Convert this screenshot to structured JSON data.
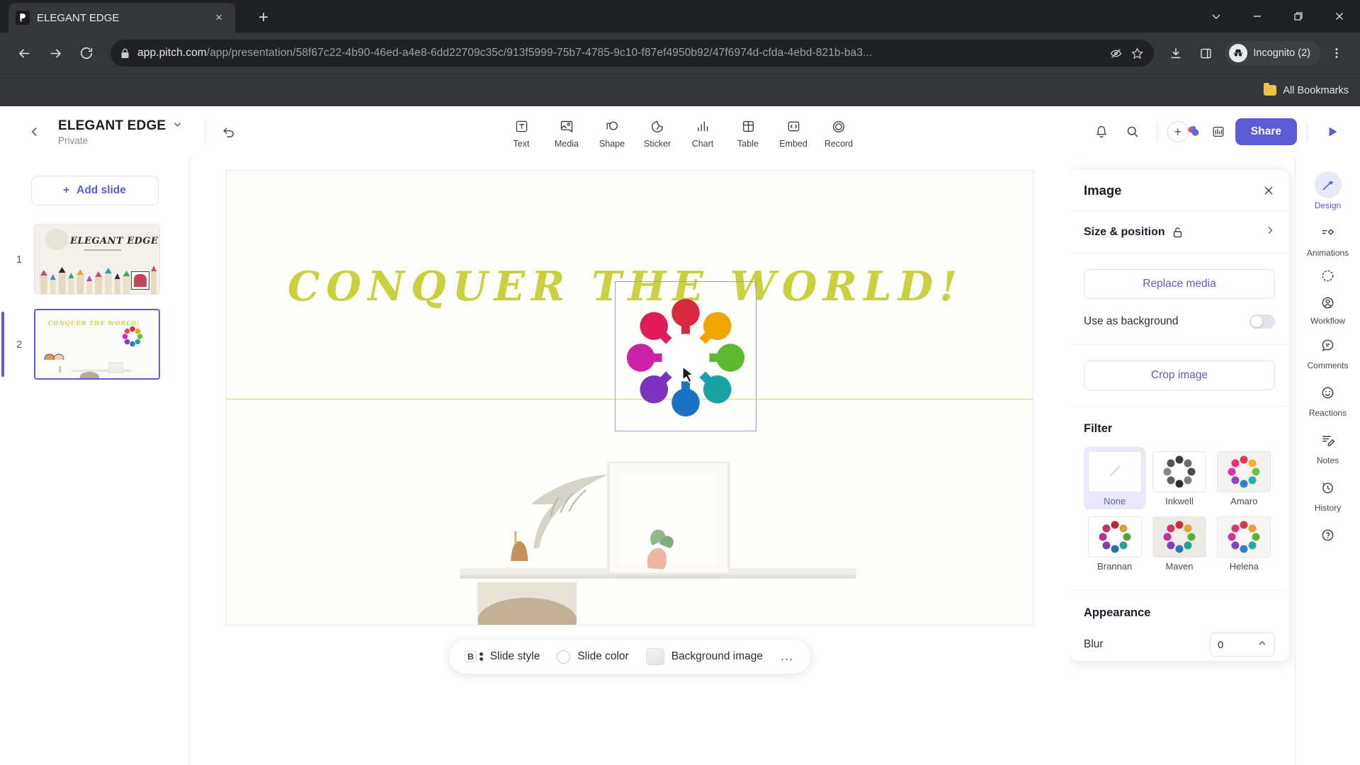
{
  "browser": {
    "tab": {
      "title": "ELEGANT EDGE",
      "favicon": "pitch-logo-icon",
      "close": "×"
    },
    "new_tab": "+",
    "window_controls": [
      "chevron-down-icon",
      "minimize-icon",
      "restore-icon",
      "close-icon"
    ],
    "nav": {
      "back": "back-icon",
      "forward": "forward-icon",
      "reload": "reload-icon"
    },
    "omnibox": {
      "lock": "lock-icon",
      "domain": "app.pitch.com",
      "path": "/app/presentation/58f67c22-4b90-46ed-a4e8-6dd22709c35c/913f5999-75b7-4785-9c10-f87ef4950b92/47f6974d-cfda-4ebd-821b-ba3...",
      "tracking_protection": "eye-slash-icon",
      "bookmark": "star-icon"
    },
    "toolbar_icons": [
      "download-icon",
      "side-panel-icon"
    ],
    "profile": {
      "label": "Incognito (2)",
      "icon": "incognito-icon"
    },
    "menu": "kebab-menu-icon",
    "bookmarks_bar": {
      "label": "All Bookmarks",
      "icon": "folder-icon"
    }
  },
  "app": {
    "header": {
      "back": "chevron-left-icon",
      "deck_title": "ELEGANT EDGE",
      "deck_title_caret": "chevron-down-icon",
      "privacy": "Private",
      "undo": "undo-icon",
      "insert_tools": [
        {
          "label": "Text",
          "icon": "text-icon"
        },
        {
          "label": "Media",
          "icon": "media-icon"
        },
        {
          "label": "Shape",
          "icon": "shape-icon"
        },
        {
          "label": "Sticker",
          "icon": "sticker-icon"
        },
        {
          "label": "Chart",
          "icon": "chart-icon"
        },
        {
          "label": "Table",
          "icon": "table-icon"
        },
        {
          "label": "Embed",
          "icon": "embed-icon"
        },
        {
          "label": "Record",
          "icon": "record-icon"
        }
      ],
      "notifications": "bell-icon",
      "search": "search-icon",
      "add_collaborator": "plus-icon",
      "analytics": "analytics-icon",
      "share_label": "Share",
      "present": "play-icon"
    },
    "slides_pane": {
      "add_slide_label": "Add slide",
      "add_slide_icon": "plus-icon",
      "slides": [
        {
          "number": "1",
          "title": "ELEGANT EDGE",
          "active": false
        },
        {
          "number": "2",
          "title": "CONQUER THE WORLD!",
          "active": true
        }
      ]
    },
    "canvas": {
      "headline": "CONQUER THE WORLD!",
      "headline_color": "#c9d13f",
      "selected_element": "star-people-image",
      "cursor": "pointer-cursor"
    },
    "style_bar": {
      "slide_style": "Slide style",
      "slide_style_icon": "text-style-icon",
      "slide_color": "Slide color",
      "slide_color_icon": "color-circle-icon",
      "background_image": "Background image",
      "background_image_icon": "image-swatch-icon",
      "more": "…"
    },
    "right_panel": {
      "title": "Image",
      "close": "close-icon",
      "size_position": {
        "label": "Size & position",
        "lock_icon": "unlock-icon",
        "chevron": "chevron-right-icon"
      },
      "replace_media": "Replace media",
      "use_as_background": "Use as background",
      "use_as_background_on": false,
      "crop_image": "Crop image",
      "filter_title": "Filter",
      "filters": [
        {
          "name": "None",
          "selected": true
        },
        {
          "name": "Inkwell",
          "selected": false
        },
        {
          "name": "Amaro",
          "selected": false
        },
        {
          "name": "Brannan",
          "selected": false
        },
        {
          "name": "Maven",
          "selected": false
        },
        {
          "name": "Helena",
          "selected": false
        }
      ],
      "appearance_title": "Appearance",
      "blur_label": "Blur",
      "blur_value": "0",
      "blur_caret": "caret-up-icon"
    },
    "right_rail": [
      {
        "label": "Design",
        "icon": "design-wand-icon",
        "active": true
      },
      {
        "label": "Animations",
        "icon": "animations-icon",
        "active": false
      },
      {
        "label": "Workflow",
        "icon": "workflow-check-icon",
        "icon2": "workflow-person-icon",
        "active": false
      },
      {
        "label": "Comments",
        "icon": "comment-icon",
        "active": false
      },
      {
        "label": "Reactions",
        "icon": "smiley-icon",
        "active": false
      },
      {
        "label": "Notes",
        "icon": "notes-icon",
        "active": false
      },
      {
        "label": "History",
        "icon": "history-icon",
        "active": false
      },
      {
        "label": "",
        "icon": "help-icon",
        "active": false
      }
    ]
  },
  "colors": {
    "accent": "#5b5bd6",
    "accent_soft": "#e9e9fb",
    "headline": "#c9d13f",
    "chrome_dark": "#35363a",
    "chrome_darker": "#202124"
  }
}
